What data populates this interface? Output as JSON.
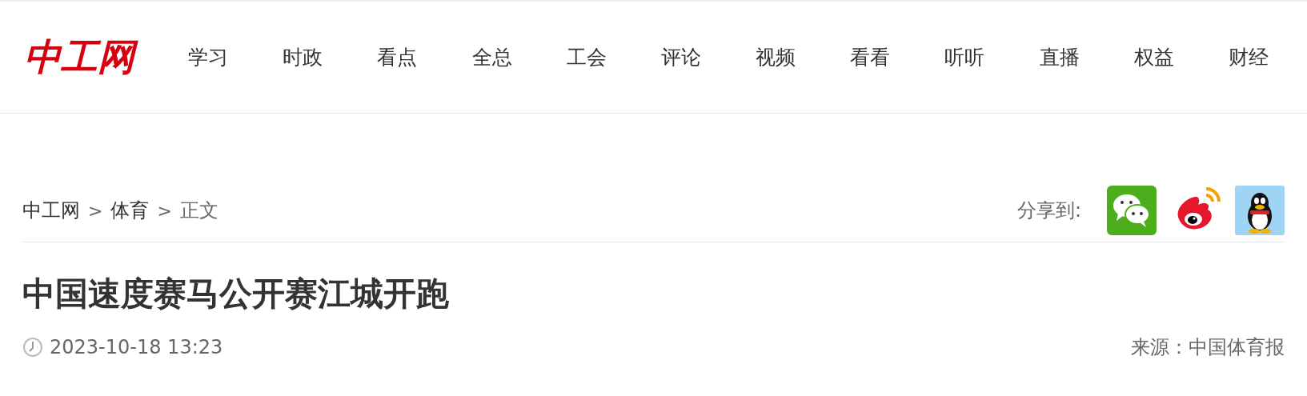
{
  "logo": {
    "text": "中工网"
  },
  "nav": [
    {
      "label": "学习"
    },
    {
      "label": "时政"
    },
    {
      "label": "看点"
    },
    {
      "label": "全总"
    },
    {
      "label": "工会"
    },
    {
      "label": "评论"
    },
    {
      "label": "视频"
    },
    {
      "label": "看看"
    },
    {
      "label": "听听"
    },
    {
      "label": "直播"
    },
    {
      "label": "权益"
    },
    {
      "label": "财经"
    }
  ],
  "breadcrumb": [
    {
      "label": "中工网",
      "kind": "link"
    },
    {
      "label": ">",
      "kind": "sep"
    },
    {
      "label": "体育",
      "kind": "link"
    },
    {
      "label": ">",
      "kind": "sep"
    },
    {
      "label": "正文",
      "kind": "current"
    }
  ],
  "share": {
    "label": "分享到:",
    "targets": [
      {
        "kind": "wechat"
      },
      {
        "kind": "weibo"
      },
      {
        "kind": "qq"
      }
    ]
  },
  "article": {
    "title": "中国速度赛马公开赛江城开跑",
    "date": "2023-10-18 13:23",
    "source": "来源：中国体育报"
  }
}
